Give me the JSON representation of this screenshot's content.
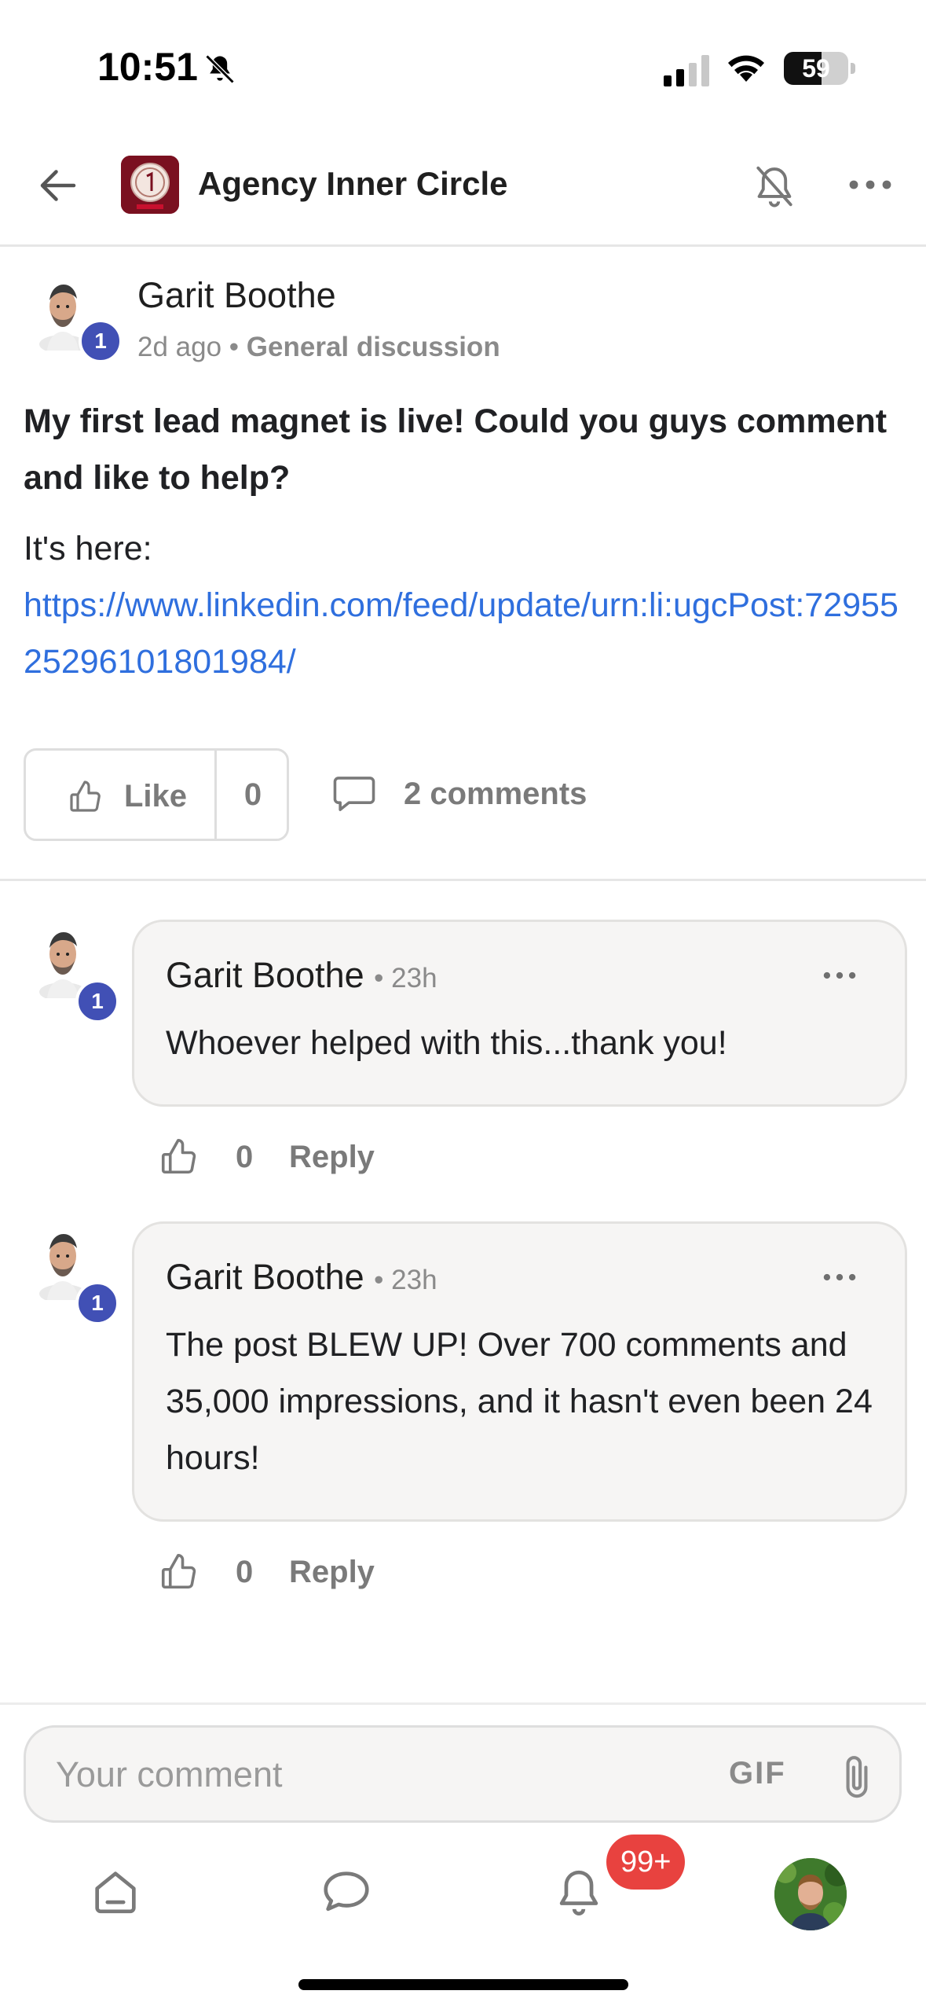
{
  "status_bar": {
    "time": "10:51",
    "battery": "59",
    "battery_level_percent": 59
  },
  "header": {
    "group_name": "Agency Inner Circle"
  },
  "post": {
    "author": "Garit Boothe",
    "level": "1",
    "time": "2d ago",
    "separator": "•",
    "category": "General discussion",
    "title": "My first lead magnet is live! Could you guys comment and like to help?",
    "body": "It's here:",
    "link": "https://www.linkedin.com/feed/update/urn:li:ugcPost:7295525296101801984/",
    "like_label": "Like",
    "like_count": "0",
    "comments_label": "2 comments"
  },
  "comments": [
    {
      "author": "Garit Boothe",
      "level": "1",
      "time": "• 23h",
      "text": "Whoever helped with this...thank you!",
      "like_count": "0",
      "reply_label": "Reply"
    },
    {
      "author": "Garit Boothe",
      "level": "1",
      "time": "• 23h",
      "text": "The post BLEW UP! Over 700 comments and 35,000 impressions, and it hasn't even been 24 hours!",
      "like_count": "0",
      "reply_label": "Reply"
    }
  ],
  "composer": {
    "placeholder": "Your comment",
    "gif_label": "GIF"
  },
  "nav": {
    "notifications_badge": "99+",
    "items": [
      "home-icon",
      "chat-icon",
      "bell-icon",
      "profile-avatar"
    ]
  },
  "colors": {
    "link": "#2f6fde",
    "level_badge": "#4150b5",
    "notification_badge": "#e8423f",
    "bubble_bg": "#f6f5f4"
  }
}
